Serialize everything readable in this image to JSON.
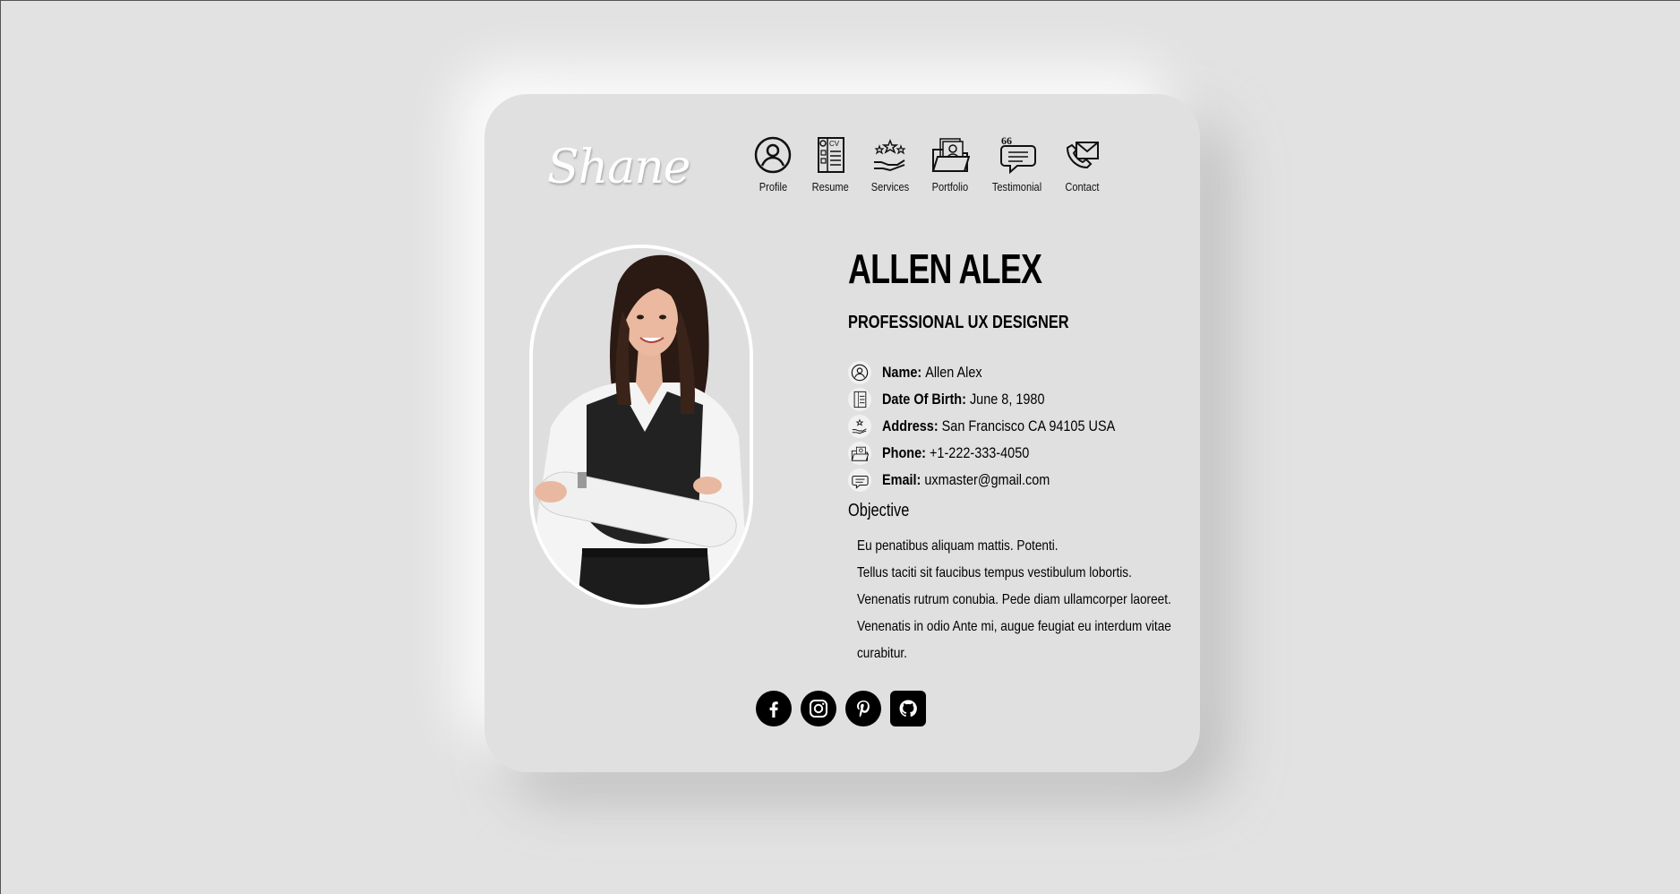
{
  "logo": "Shane",
  "nav": [
    {
      "label": "Profile",
      "icon": "profile-icon"
    },
    {
      "label": "Resume",
      "icon": "resume-icon"
    },
    {
      "label": "Services",
      "icon": "services-icon"
    },
    {
      "label": "Portfolio",
      "icon": "portfolio-icon"
    },
    {
      "label": "Testimonial",
      "icon": "testimonial-icon"
    },
    {
      "label": "Contact",
      "icon": "contact-icon"
    }
  ],
  "profile": {
    "name": "ALLEN ALEX",
    "title": "PROFESSIONAL UX DESIGNER",
    "info": [
      {
        "label": "Name:",
        "value": "Allen Alex",
        "icon": "profile-icon"
      },
      {
        "label": "Date Of Birth:",
        "value": "June 8, 1980",
        "icon": "resume-icon"
      },
      {
        "label": "Address:",
        "value": "San Francisco CA 94105 USA",
        "icon": "services-icon"
      },
      {
        "label": "Phone:",
        "value": "+1-222-333-4050",
        "icon": "portfolio-icon"
      },
      {
        "label": "Email:",
        "value": "uxmaster@gmail.com",
        "icon": "testimonial-icon"
      }
    ]
  },
  "objective": {
    "heading": "Objective",
    "lines": [
      "Eu penatibus aliquam mattis. Potenti.",
      "Tellus taciti sit faucibus tempus vestibulum lobortis.",
      "Venenatis rutrum conubia. Pede diam ullamcorper laoreet.",
      "Venenatis in odio Ante mi, augue feugiat eu interdum vitae",
      "curabitur."
    ]
  },
  "social": [
    "facebook-icon",
    "instagram-icon",
    "pinterest-icon",
    "github-icon"
  ]
}
